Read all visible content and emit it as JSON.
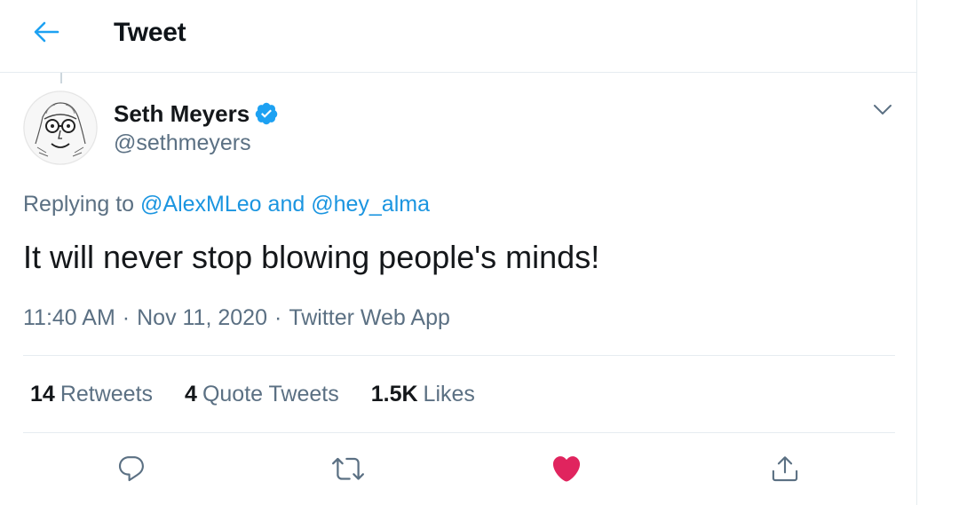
{
  "header": {
    "title": "Tweet",
    "back_icon": "back-arrow-icon",
    "accent_color": "#1da1f2"
  },
  "author": {
    "name": "Seth Meyers",
    "handle": "@sethmeyers",
    "verified": true,
    "avatar_icon": "avatar-sketch"
  },
  "reply": {
    "prefix": "Replying to",
    "user1": "@AlexMLeo",
    "joiner": "and",
    "user2": "@hey_alma"
  },
  "tweet": {
    "text": "It will never stop blowing people's minds!"
  },
  "meta": {
    "time": "11:40 AM",
    "separator": "·",
    "date": "Nov 11, 2020",
    "source": "Twitter Web App"
  },
  "stats": {
    "retweets": {
      "count": "14",
      "label": "Retweets"
    },
    "quotes": {
      "count": "4",
      "label": "Quote Tweets"
    },
    "likes": {
      "count": "1.5K",
      "label": "Likes"
    }
  },
  "actions": {
    "reply_icon": "reply-icon",
    "retweet_icon": "retweet-icon",
    "like_icon": "heart-icon",
    "share_icon": "share-icon",
    "like_color": "#e0245e",
    "icon_color": "#5b7083"
  }
}
